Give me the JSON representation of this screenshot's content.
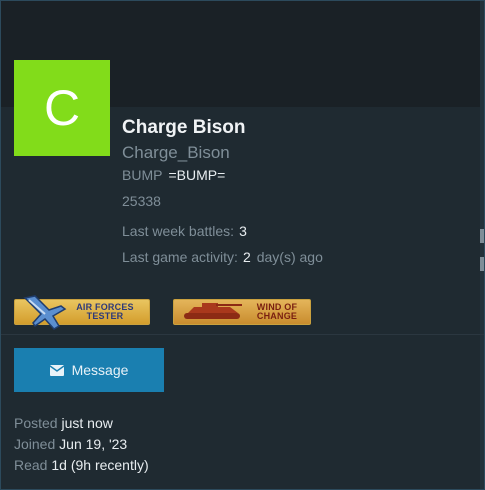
{
  "profile": {
    "avatar_letter": "C",
    "avatar_color": "#82dc1a",
    "display_name": "Charge Bison",
    "username": "Charge_Bison",
    "title_label": "BUMP",
    "title_value": "=BUMP=",
    "post_count": "25338"
  },
  "stats": {
    "battles_label": "Last week battles:",
    "battles_value": "3",
    "activity_label": "Last game activity:",
    "activity_value": "2",
    "activity_unit": "day(s) ago"
  },
  "badges": [
    {
      "line1": "AIR FORCES",
      "line2": "TESTER",
      "icon": "airplane-icon"
    },
    {
      "line1": "WIND OF",
      "line2": "CHANGE",
      "icon": "tank-icon"
    }
  ],
  "actions": {
    "message_label": "Message",
    "message_icon": "envelope-icon"
  },
  "meta": {
    "posted_label": "Posted",
    "posted_value": "just now",
    "joined_label": "Joined",
    "joined_value": "Jun 19, '23",
    "read_label": "Read",
    "read_value": "1d (9h recently)"
  },
  "colors": {
    "accent": "#1a7fb0",
    "background": "#1f2a31",
    "muted_text": "#7f8e98"
  }
}
